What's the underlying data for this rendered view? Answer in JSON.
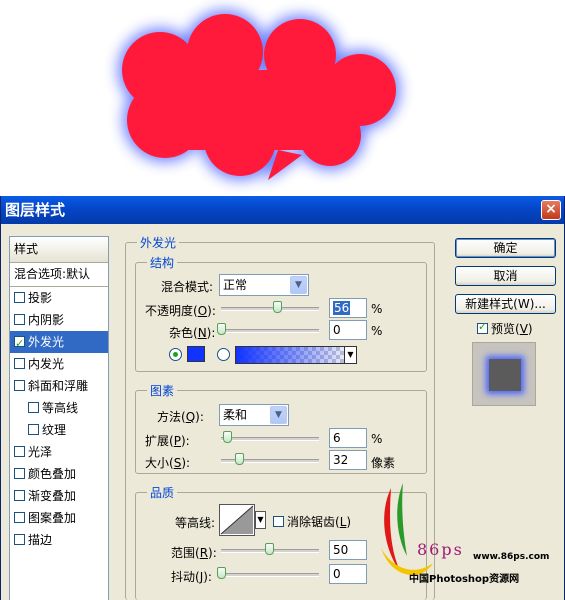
{
  "dialog": {
    "title": "图层样式"
  },
  "styles_panel": {
    "header": "样式",
    "blend_default": "混合选项:默认",
    "items": [
      {
        "label": "投影",
        "checked": false
      },
      {
        "label": "内阴影",
        "checked": false
      },
      {
        "label": "外发光",
        "checked": true
      },
      {
        "label": "内发光",
        "checked": false
      },
      {
        "label": "斜面和浮雕",
        "checked": false
      },
      {
        "label": "等高线",
        "checked": false
      },
      {
        "label": "纹理",
        "checked": false
      },
      {
        "label": "光泽",
        "checked": false
      },
      {
        "label": "颜色叠加",
        "checked": false
      },
      {
        "label": "渐变叠加",
        "checked": false
      },
      {
        "label": "图案叠加",
        "checked": false
      },
      {
        "label": "描边",
        "checked": false
      }
    ]
  },
  "outer_glow": {
    "title": "外发光",
    "structure": {
      "title": "结构",
      "blend_mode_label": "混合模式:",
      "blend_mode_value": "正常",
      "opacity_label": "不透明度(",
      "opacity_key": "O",
      "opacity_label_end": "):",
      "opacity_value": "56",
      "opacity_unit": "%",
      "noise_label": "杂色(",
      "noise_key": "N",
      "noise_label_end": "):",
      "noise_value": "0",
      "noise_unit": "%"
    },
    "elements": {
      "title": "图素",
      "method_label": "方法(",
      "method_key": "Q",
      "method_label_end": "):",
      "method_value": "柔和",
      "spread_label": "扩展(",
      "spread_key": "P",
      "spread_label_end": "):",
      "spread_value": "6",
      "spread_unit": "%",
      "size_label": "大小(",
      "size_key": "S",
      "size_label_end": "):",
      "size_value": "32",
      "size_unit": "像素"
    },
    "quality": {
      "title": "品质",
      "contour_label": "等高线:",
      "anti_alias_label": "消除锯齿(",
      "anti_alias_key": "L",
      "anti_alias_label_end": ")",
      "range_label": "范围(",
      "range_key": "R",
      "range_label_end": "):",
      "range_value": "50",
      "jitter_label": "抖动(",
      "jitter_key": "J",
      "jitter_label_end": "):",
      "jitter_value": "0"
    }
  },
  "buttons": {
    "ok": "确定",
    "cancel": "取消",
    "new_style": "新建样式(W)...",
    "preview_label": "预览(",
    "preview_key": "V",
    "preview_label_end": ")"
  },
  "watermark": {
    "logo": "86ps",
    "url": "www.86ps.com",
    "cn": "中国Photoshop资源网"
  },
  "colors": {
    "glow": "#1133ff",
    "shape": "#ff1a3c",
    "accent": "#316ac5"
  }
}
